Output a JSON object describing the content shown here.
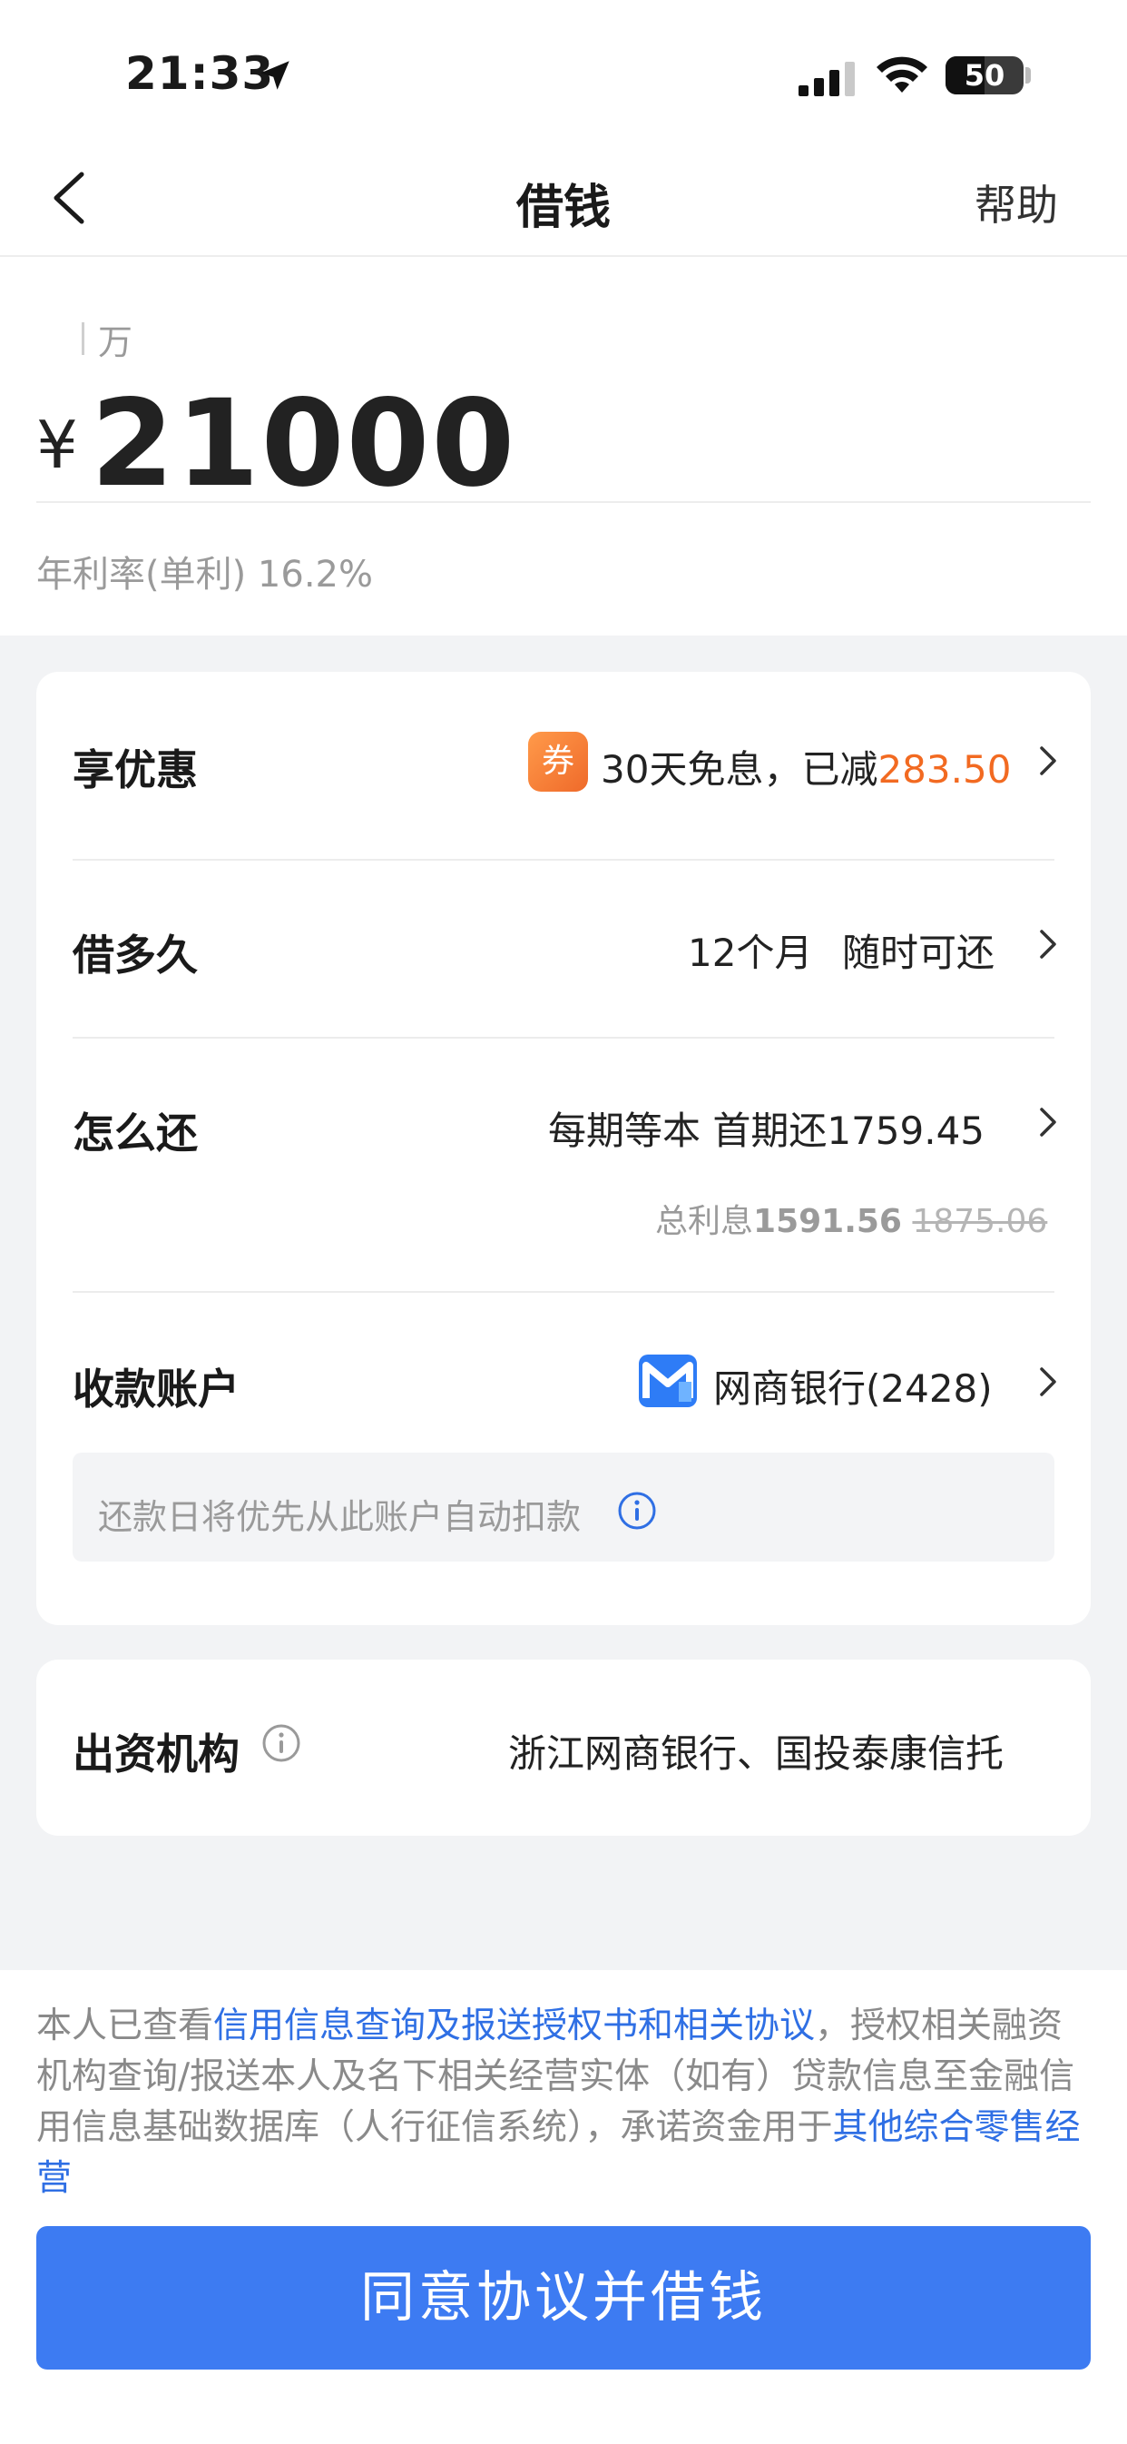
{
  "status_bar": {
    "time": "21:33",
    "battery": "50"
  },
  "nav": {
    "title": "借钱",
    "help_label": "帮助"
  },
  "amount": {
    "unit_hint": "万",
    "currency": "¥",
    "value": "21000",
    "rate_text": "年利率(单利) 16.2%"
  },
  "discount": {
    "label": "享优惠",
    "coupon_badge": "券",
    "text": "30天免息，已减",
    "amount": "283.50"
  },
  "term": {
    "label": "借多久",
    "months": "12个月",
    "note": "随时可还"
  },
  "repay": {
    "label": "怎么还",
    "value": "每期等本 首期还1759.45",
    "interest_prefix": "总利息",
    "interest_value": "1591.56",
    "interest_original": "1875.06"
  },
  "account": {
    "label": "收款账户",
    "bank": "网商银行(2428)",
    "note": "还款日将优先从此账户自动扣款"
  },
  "funder": {
    "label": "出资机构",
    "value": "浙江网商银行、国投泰康信托"
  },
  "legal": {
    "part1": "本人已查看",
    "link1": "信用信息查询及报送授权书和相关协议",
    "part2": "，授权相关融资机构查询/报送本人及名下相关经营实体（如有）贷款信息至金融信用信息基础数据库（人行征信系统），承诺资金用于",
    "link2": "其他综合零售经营"
  },
  "cta": {
    "label": "同意协议并借钱"
  },
  "colors": {
    "accent": "#3d7bf2",
    "orange": "#f26a21",
    "link": "#2f6fe4"
  }
}
